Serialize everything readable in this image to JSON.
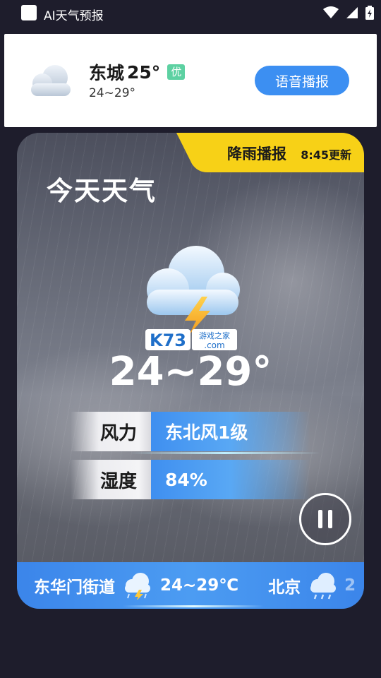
{
  "status_bar": {
    "title": "AI天气预报"
  },
  "top_card": {
    "city": "东城",
    "temperature": "25°",
    "aqi_badge": "优",
    "range": "24~29°",
    "voice_button": "语音播报"
  },
  "main_card": {
    "banner_title": "降雨播报",
    "banner_time": "8:45更新",
    "heading": "今天天气",
    "temp_range": "24~29°",
    "wind_label": "风力",
    "wind_value": "东北风1级",
    "humidity_label": "湿度",
    "humidity_value": "84%",
    "watermark": {
      "brand": "K73",
      "text": "游戏之家",
      "domain": ".com"
    }
  },
  "ticker": {
    "items": [
      {
        "place": "东华门街道",
        "icon": "thunder-shower-icon",
        "range": "24~29℃"
      },
      {
        "place": "北京",
        "icon": "rain-cloud-icon",
        "range": "2"
      }
    ]
  },
  "colors": {
    "accent_blue": "#3c8ff2",
    "banner_yellow": "#f7d117",
    "aqi_green": "#5dd1a2",
    "background": "#1e1d2c"
  }
}
